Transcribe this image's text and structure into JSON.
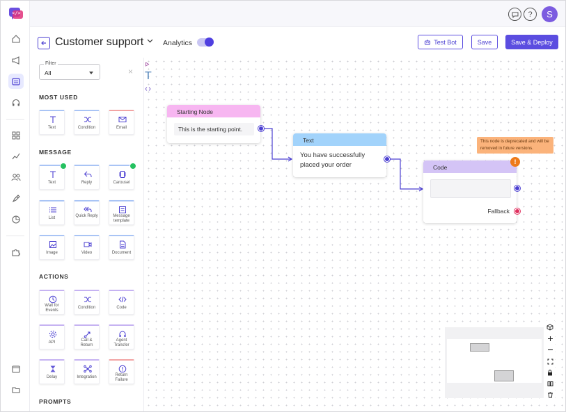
{
  "header": {
    "title": "Customer support",
    "analytics_label": "Analytics",
    "analytics_on": true,
    "test_bot": "Test Bot",
    "save": "Save",
    "save_deploy": "Save & Deploy"
  },
  "topbar": {
    "avatar_initial": "S",
    "help_glyph": "?"
  },
  "colors": {
    "accent": "#5b4de0",
    "avatar": "#7c5ce0",
    "warning": "#ee7a1a",
    "whatsapp": "#25c160"
  },
  "panel": {
    "filter_label": "Filter",
    "filter_value": "All",
    "sections": {
      "most_used": "MOST USED",
      "message": "MESSAGE",
      "actions": "ACTIONS",
      "prompts": "PROMPTS"
    },
    "most_used": [
      "Text",
      "Condition",
      "Email"
    ],
    "message": [
      "Text",
      "Reply",
      "Carousel",
      "List",
      "Quick Reply",
      "Message template",
      "Image",
      "Video",
      "Document"
    ],
    "actions": [
      "Wait for Events",
      "Condition",
      "Code",
      "API",
      "Call & Return",
      "Agent Transfer",
      "Delay",
      "Integration",
      "Return Failure"
    ]
  },
  "canvas": {
    "start_node": {
      "title": "Starting Node",
      "text": "This is the starting point."
    },
    "text_node": {
      "title": "Text",
      "text": "You have successfully placed your order",
      "icon_glyph": "T"
    },
    "code_node": {
      "title": "Code",
      "fallback": "Fallback",
      "warn_glyph": "!"
    },
    "deprecation_tip": "This node is deprecated and will be removed in future versions."
  }
}
